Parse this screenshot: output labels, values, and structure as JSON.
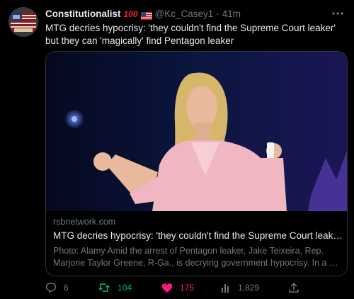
{
  "tweet": {
    "display_name": "Constitutionalist",
    "name_emoji": "100",
    "handle": "@Kc_Casey1",
    "separator": "·",
    "timestamp": "41m",
    "text": "MTG decries hypocrisy: 'they couldn't find the Supreme Court leaker' but they can 'magically' find Pentagon leaker",
    "more_icon": "more-horizontal-icon"
  },
  "card": {
    "domain": "rsbnetwork.com",
    "title": "MTG decries hypocrisy: 'they couldn't find the Supreme Court leaker' but they can 'magically' find Pentagon leaker",
    "description": "Photo: Alamy Amid the arrest of Pentagon leaker, Jake Teixeira, Rep. Marjorie Taylor Greene, R-Ga., is decrying government hypocrisy. In a …"
  },
  "actions": {
    "reply_count": "6",
    "retweet_count": "104",
    "like_count": "175",
    "view_count": "1,829"
  },
  "colors": {
    "background": "#000000",
    "text": "#e7e9ea",
    "muted": "#71767b",
    "retweet": "#00ba7c",
    "like": "#f91880",
    "border": "#2f3336"
  }
}
